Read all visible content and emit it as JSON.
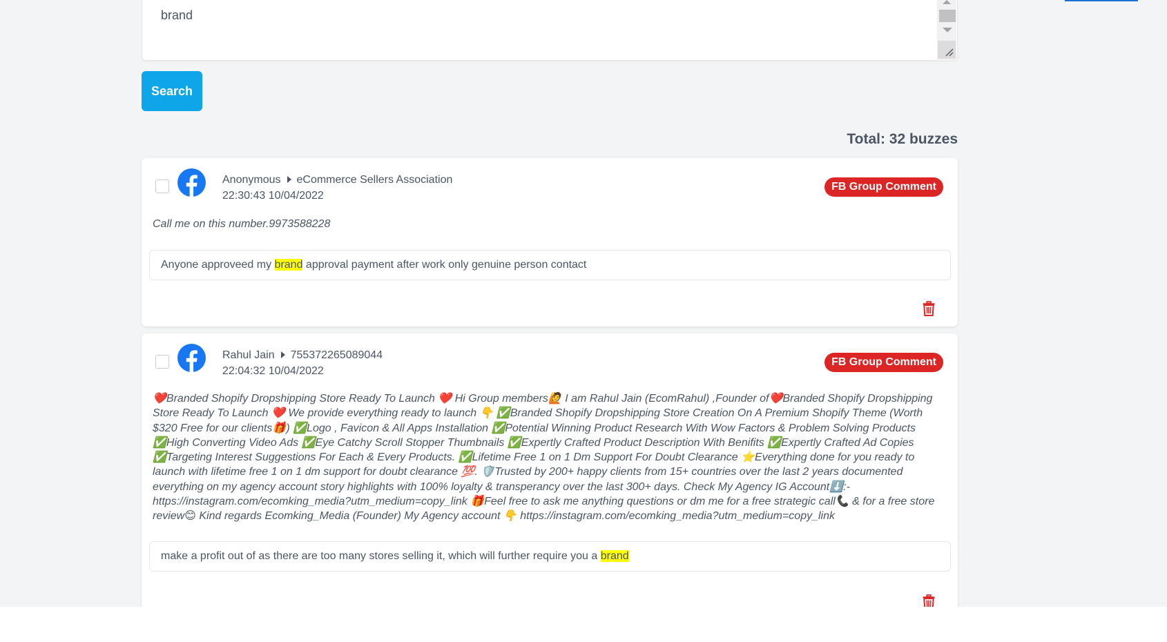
{
  "query": {
    "value": "brand"
  },
  "search_button": {
    "label": "Search"
  },
  "results": {
    "total_label": "Total: 32 buzzes"
  },
  "posts": [
    {
      "author": "Anonymous",
      "target": "eCommerce Sellers Association",
      "timestamp": "22:30:43 10/04/2022",
      "badge": "FB Group Comment",
      "text": "Call me on this number.9973588228",
      "excerpt_before": "Anyone approveed my ",
      "excerpt_highlight": "brand",
      "excerpt_after": " approval payment after work only genuine person contact"
    },
    {
      "author": "Rahul Jain",
      "target": "755372265089044",
      "timestamp": "22:04:32 10/04/2022",
      "badge": "FB Group Comment",
      "text": "❤️Branded Shopify Dropshipping Store Ready To Launch ❤️ Hi Group members🙋 I am Rahul Jain (EcomRahul) ,Founder of❤️Branded Shopify Dropshipping Store Ready To Launch ❤️ We provide everything ready to launch 👇 ✅Branded Shopify Dropshipping Store Creation On A Premium Shopify Theme (Worth $320 Free for our clients🎁) ✅Logo , Favicon & All Apps Installation ✅Potential Winning Product Research With Wow Factors & Problem Solving Products ✅High Converting Video Ads ✅Eye Catchy Scroll Stopper Thumbnails ✅Expertly Crafted Product Description With Benifits ✅Expertly Crafted Ad Copies ✅Targeting Interest Suggestions For Each & Every Products. ✅Lifetime Free 1 on 1 Dm Support For Doubt Clearance ⭐Everything done for you ready to launch with lifetime free 1 on 1 dm support for doubt clearance 💯. 🛡️Trusted by 200+ happy clients from 15+ countries over the last 2 years documented everything on my agency account story highlights with 100% loyalty & transperancy over the last 300+ days. Check My Agency IG Account⬇️:- https://instagram.com/ecomking_media?utm_medium=copy_link 🎁Feel free to ask me anything questions or dm me for a free strategic call📞 & for a free store review😊 Kind regards Ecomking_Media (Founder) My Agency account 👇 https://instagram.com/ecomking_media?utm_medium=copy_link",
      "excerpt_before": "make a profit out of as there are too many stores selling it, which will further require you a ",
      "excerpt_highlight": "brand",
      "excerpt_after": ""
    }
  ],
  "icons": {
    "source": "facebook-icon",
    "delete": "trash-icon"
  },
  "colors": {
    "primary": "#0ea5e9",
    "badge": "#dc2626",
    "facebook": "#1877f2",
    "highlight": "#ffff00",
    "background": "#f3f4f6"
  }
}
